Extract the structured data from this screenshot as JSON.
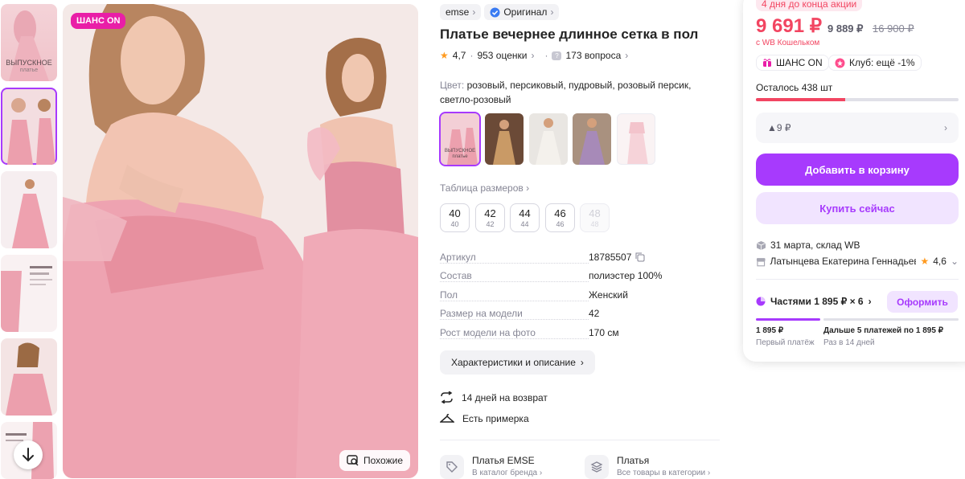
{
  "thumbnails": [
    {
      "caption": "ВЫПУСКНОЕ",
      "sub": "платье"
    },
    {
      "caption": "",
      "sub": ""
    },
    {
      "caption": "",
      "sub": ""
    },
    {
      "caption": "",
      "sub": ""
    },
    {
      "caption": "",
      "sub": ""
    },
    {
      "caption": "",
      "sub": ""
    }
  ],
  "main_image": {
    "badge": "ШАНС ON",
    "similar_label": "Похожие"
  },
  "brand": {
    "name": "emse",
    "original": "Оригинал"
  },
  "product": {
    "title": "Платье вечернее длинное сетка в пол",
    "rating": "4,7",
    "reviews": "953 оценки",
    "questions": "173 вопроса",
    "color_label": "Цвет:",
    "color_value": "розовый, персиковый, пудровый, розовый персик, светло-розовый"
  },
  "swatches": [
    {
      "caption": "ВЫПУСКНОЕ",
      "sub": "платье"
    },
    {
      "caption": "",
      "sub": ""
    },
    {
      "caption": "",
      "sub": ""
    },
    {
      "caption": "",
      "sub": ""
    },
    {
      "caption": "",
      "sub": ""
    }
  ],
  "sizes": {
    "table_label": "Таблица размеров",
    "items": [
      {
        "size": "40",
        "ru": "40"
      },
      {
        "size": "42",
        "ru": "42"
      },
      {
        "size": "44",
        "ru": "44"
      },
      {
        "size": "46",
        "ru": "46"
      },
      {
        "size": "48",
        "ru": "48"
      }
    ]
  },
  "specs": [
    {
      "k": "Артикул",
      "v": "18785507"
    },
    {
      "k": "Состав",
      "v": "полиэстер 100%"
    },
    {
      "k": "Пол",
      "v": "Женский"
    },
    {
      "k": "Размер на модели",
      "v": "42"
    },
    {
      "k": "Рост модели на фото",
      "v": "170 см"
    }
  ],
  "desc_button": "Характеристики и описание",
  "features": [
    {
      "text": "14 дней на возврат"
    },
    {
      "text": "Есть примерка"
    }
  ],
  "brand_links": [
    {
      "title": "Платья EMSE",
      "sub": "В каталог бренда"
    },
    {
      "title": "Платья",
      "sub": "Все товары в категории"
    }
  ],
  "buy_panel": {
    "promo": "4 дня до конца акции",
    "price": "9 691 ₽",
    "price_old": "9 889 ₽",
    "price_crossed": "16 900 ₽",
    "wallet": "с WB Кошельком",
    "tag_chance": "ШАНС ON",
    "tag_club": "Клуб: ещё -1%",
    "stock": "Осталось 438 шт",
    "stock_fraction": 0.44,
    "delivery_price": "▲9 ₽",
    "add_to_cart": "Добавить в корзину",
    "buy_now": "Купить сейчас",
    "delivery_date": "31 марта, склад WB",
    "seller": "Латынцева Екатерина Геннадьевна",
    "seller_rating": "4,6",
    "installments": "Частями 1 895 ₽ × 6",
    "installments_btn": "Оформить",
    "first_amount": "1 895 ₽",
    "first_label": "Первый платёж",
    "next_amount": "Дальше 5 платежей по 1 895 ₽",
    "next_label": "Раз в 14 дней"
  },
  "colors": {
    "accent": "#a73afd",
    "price": "#f24561",
    "badge": "#e91ea7"
  }
}
